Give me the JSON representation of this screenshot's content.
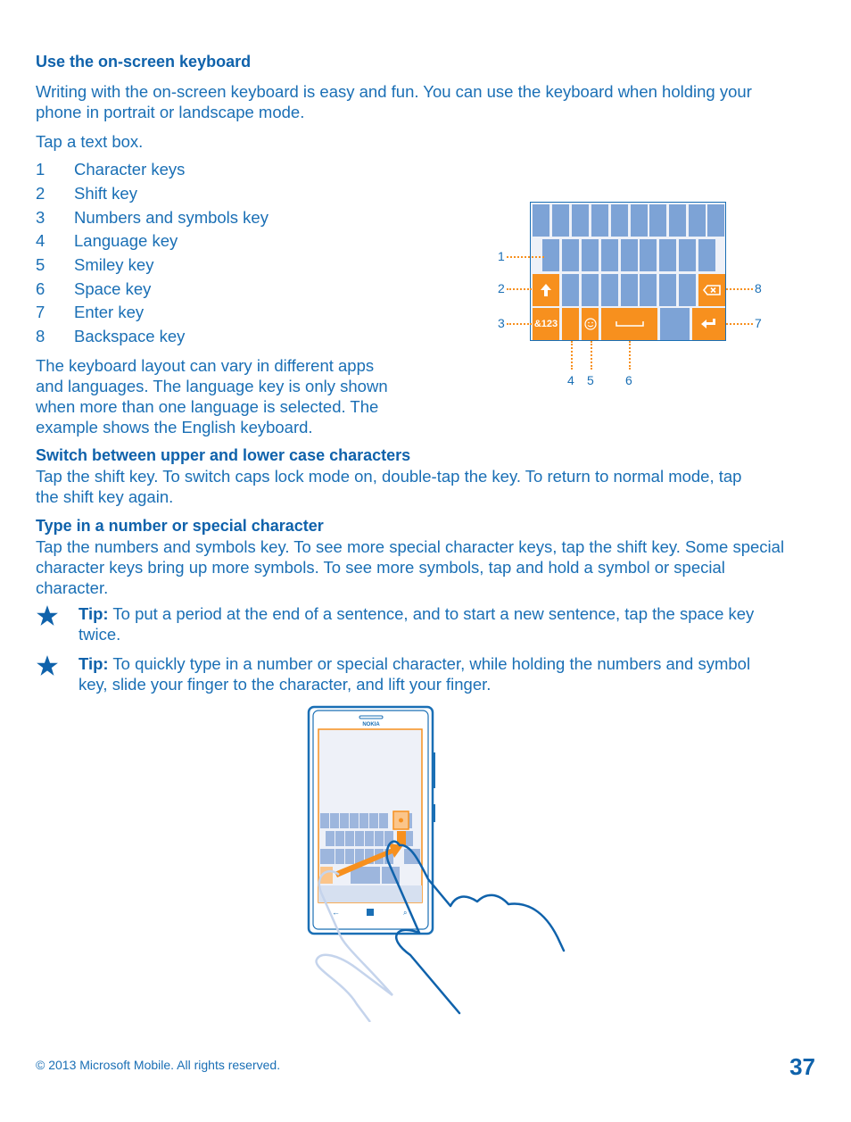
{
  "section": {
    "title": "Use the on-screen keyboard",
    "intro_line1": "Writing with the on-screen keyboard is easy and fun. You can use the keyboard when holding your",
    "intro_line2": "phone in portrait or landscape mode.",
    "step": "Tap a text box."
  },
  "key_list": [
    {
      "num": "1",
      "label": "Character keys"
    },
    {
      "num": "2",
      "label": "Shift key"
    },
    {
      "num": "3",
      "label": "Numbers and symbols key"
    },
    {
      "num": "4",
      "label": "Language key"
    },
    {
      "num": "5",
      "label": "Smiley key"
    },
    {
      "num": "6",
      "label": "Space key"
    },
    {
      "num": "7",
      "label": "Enter key"
    },
    {
      "num": "8",
      "label": "Backspace key"
    }
  ],
  "layout_note": [
    "The keyboard layout can vary in different apps",
    "and languages. The language key is only shown",
    "when more than one language is selected. The",
    "example shows the English keyboard."
  ],
  "keyboard_figure": {
    "numbers_key_label": "&123",
    "callouts": [
      "1",
      "2",
      "3",
      "4",
      "5",
      "6",
      "7",
      "8"
    ]
  },
  "case_section": {
    "title": "Switch between upper and lower case characters",
    "line1": "Tap the shift key. To switch caps lock mode on, double-tap the key. To return to normal mode, tap",
    "line2": "the shift key again."
  },
  "special_section": {
    "title": "Type in a number or special character",
    "line1": "Tap the numbers and symbols key. To see more special character keys, tap the shift key. Some special",
    "line2": "character keys bring up more symbols. To see more symbols, tap and hold a symbol or special",
    "line3": "character."
  },
  "tips": [
    {
      "label": "Tip:",
      "line1": " To put a period at the end of a sentence, and to start a new sentence, tap the space key",
      "line2": "twice."
    },
    {
      "label": "Tip:",
      "line1": " To quickly type in a number or special character, while holding the numbers and symbol",
      "line2": "key, slide your finger to the character, and lift your finger."
    }
  ],
  "phone_figure": {
    "brand": "NOKIA"
  },
  "footer": {
    "copyright": "© 2013 Microsoft Mobile. All rights reserved.",
    "page_number": "37"
  }
}
